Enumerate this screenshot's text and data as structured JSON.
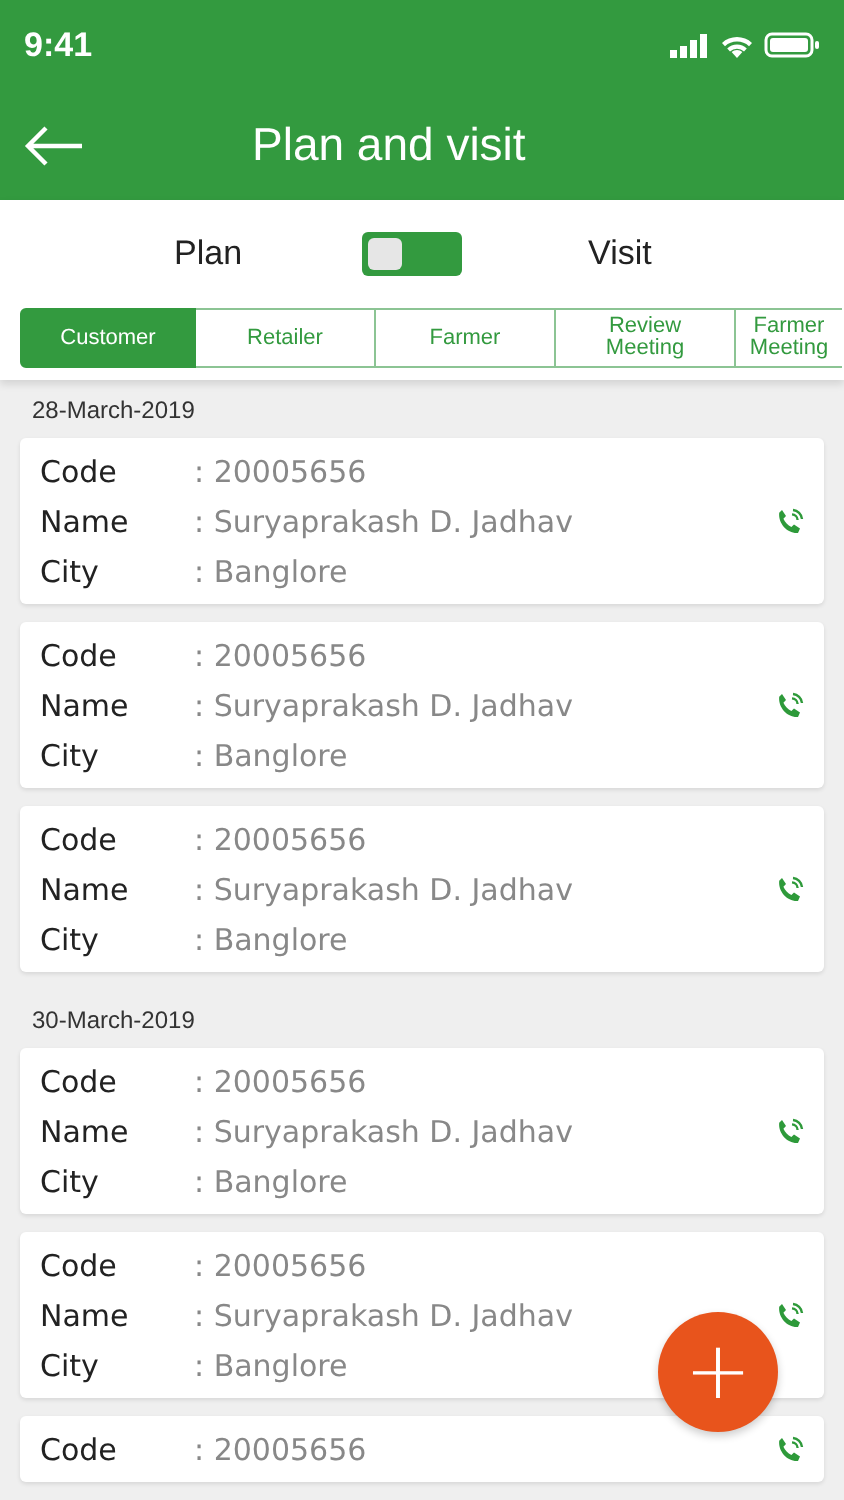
{
  "status_bar": {
    "time": "9:41"
  },
  "header": {
    "title": "Plan and visit"
  },
  "mode_switch": {
    "left_label": "Plan",
    "right_label": "Visit",
    "on": false
  },
  "tabs": [
    {
      "label": "Customer",
      "selected": true
    },
    {
      "label": "Retailer",
      "selected": false
    },
    {
      "label": "Farmer",
      "selected": false
    },
    {
      "label": "Review Meeting",
      "selected": false
    },
    {
      "label": "Farmer Meeting",
      "selected": false
    }
  ],
  "groups": [
    {
      "date": "28-March-2019",
      "entries": [
        {
          "fields": [
            {
              "label": "Code",
              "value": ": 20005656"
            },
            {
              "label": "Name",
              "value": ": Suryaprakash D. Jadhav"
            },
            {
              "label": "City",
              "value": ": Banglore"
            }
          ]
        },
        {
          "fields": [
            {
              "label": "Code",
              "value": ": 20005656"
            },
            {
              "label": "Name",
              "value": ": Suryaprakash D. Jadhav"
            },
            {
              "label": "City",
              "value": ": Banglore"
            }
          ]
        },
        {
          "fields": [
            {
              "label": "Code",
              "value": ": 20005656"
            },
            {
              "label": "Name",
              "value": ": Suryaprakash D. Jadhav"
            },
            {
              "label": "City",
              "value": ": Banglore"
            }
          ]
        }
      ]
    },
    {
      "date": "30-March-2019",
      "entries": [
        {
          "fields": [
            {
              "label": "Code",
              "value": ": 20005656"
            },
            {
              "label": "Name",
              "value": ": Suryaprakash D. Jadhav"
            },
            {
              "label": "City",
              "value": ": Banglore"
            }
          ]
        },
        {
          "fields": [
            {
              "label": "Code",
              "value": ": 20005656"
            },
            {
              "label": "Name",
              "value": ": Suryaprakash D. Jadhav"
            },
            {
              "label": "City",
              "value": ": Banglore"
            }
          ]
        },
        {
          "fields": [
            {
              "label": "Code",
              "value": ": 20005656"
            }
          ]
        }
      ]
    }
  ],
  "fab": {
    "label": "+"
  }
}
